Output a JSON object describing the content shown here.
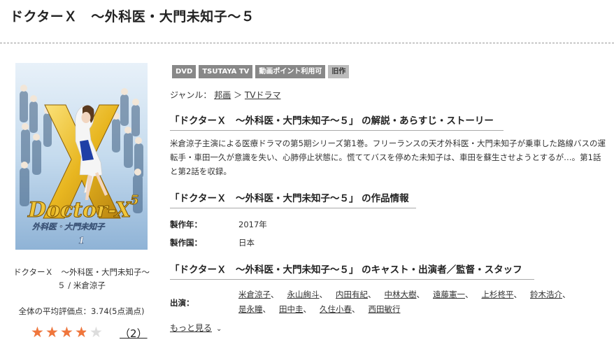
{
  "page": {
    "title": "ドクターＸ　～外科医・大門未知子～５"
  },
  "cover": {
    "alt": "Doctor-X 5 外科医・大門未知子 1",
    "logo_text": "Doctor-X",
    "logo_sub": "外科医・大門未知子",
    "logo_num": "5",
    "volume": "1",
    "caption": "ドクターＸ　～外科医・大門未知子～５ / 米倉涼子"
  },
  "rating": {
    "average_label": "全体の平均評価点：3.74(5点満点)",
    "average_value": 3.74,
    "max": 5,
    "review_count": "2",
    "colors": {
      "filled": "#f0763c",
      "empty": "#dddddd"
    }
  },
  "badges": [
    {
      "label": "DVD"
    },
    {
      "label": "TSUTAYA TV"
    },
    {
      "label": "動画ポイント利用可"
    },
    {
      "label": "旧作"
    }
  ],
  "genre": {
    "label": "ジャンル：",
    "items": [
      "邦画",
      "TVドラマ"
    ],
    "separator": "＞"
  },
  "sections": {
    "synopsis_heading": "「ドクターＸ　～外科医・大門未知子～５」 の解説・あらすじ・ストーリー",
    "synopsis_text": "米倉涼子主演による医療ドラマの第5期シリーズ第1巻。フリーランスの天才外科医・大門未知子が乗車した路線バスの運転手・車田一久が意識を失い、心肺停止状態に。慌ててバスを停めた未知子は、車田を蘇生させようとするが…。第1話と第2話を収録。",
    "info_heading": "「ドクターＸ　～外科医・大門未知子～５」 の作品情報",
    "cast_heading": "「ドクターＸ　～外科医・大門未知子～５」 のキャスト・出演者／監督・スタッフ"
  },
  "info": {
    "year_label": "製作年：",
    "year_value": "2017年",
    "country_label": "製作国：",
    "country_value": "日本"
  },
  "cast": {
    "label": "出演：",
    "members": [
      "米倉涼子",
      "永山絢斗",
      "内田有紀",
      "中林大樹",
      "遠藤憲一",
      "上杉柊平",
      "鈴木浩介",
      "是永瞳",
      "田中圭",
      "久住小春",
      "西田敏行"
    ],
    "separator": "、",
    "more_label": "もっと見る"
  }
}
